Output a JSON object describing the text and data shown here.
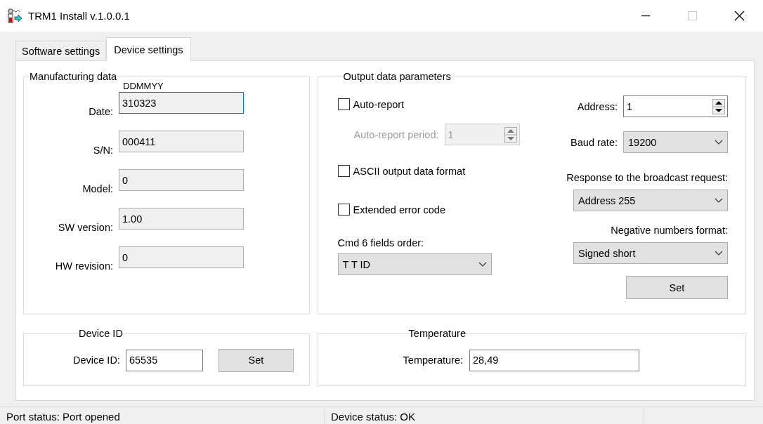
{
  "window": {
    "title": "TRM1 Install v.1.0.0.1"
  },
  "tabs": [
    {
      "label": "Software settings",
      "selected": false
    },
    {
      "label": "Device settings",
      "selected": true
    }
  ],
  "manufacturing_data": {
    "title": "Manufacturing data",
    "date_format_hint": "DDMMYY",
    "fields": [
      {
        "label": "Date:",
        "value": "310323",
        "focused": true
      },
      {
        "label": "S/N:",
        "value": "000411",
        "focused": false
      },
      {
        "label": "Model:",
        "value": "0",
        "focused": false
      },
      {
        "label": "SW version:",
        "value": "1.00",
        "focused": false
      },
      {
        "label": "HW revision:",
        "value": "0",
        "focused": false
      }
    ]
  },
  "output_data_parameters": {
    "title": "Output data parameters",
    "auto_report": {
      "label": "Auto-report",
      "checked": false
    },
    "auto_report_period": {
      "label": "Auto-report period:",
      "value": "1",
      "disabled": true
    },
    "ascii_format": {
      "label": "ASCII output data format",
      "checked": false
    },
    "extended_error_code": {
      "label": "Extended error code",
      "checked": false
    },
    "cmd6_fields_order": {
      "label": "Cmd 6 fields order:",
      "value": "T T ID"
    },
    "address": {
      "label": "Address:",
      "value": "1",
      "disabled": false
    },
    "baud_rate": {
      "label": "Baud rate:",
      "value": "19200"
    },
    "broadcast_response": {
      "label": "Response to the broadcast request:",
      "value": "Address 255"
    },
    "negative_numbers_format": {
      "label": "Negative numbers format:",
      "value": "Signed short"
    },
    "set_button": "Set"
  },
  "device_id": {
    "title": "Device ID",
    "label": "Device ID:",
    "value": "65535",
    "set_button": "Set"
  },
  "temperature": {
    "title": "Temperature",
    "label": "Temperature:",
    "value": "28,49"
  },
  "status_bar": [
    "Port status: Port opened",
    "Device status: OK"
  ]
}
